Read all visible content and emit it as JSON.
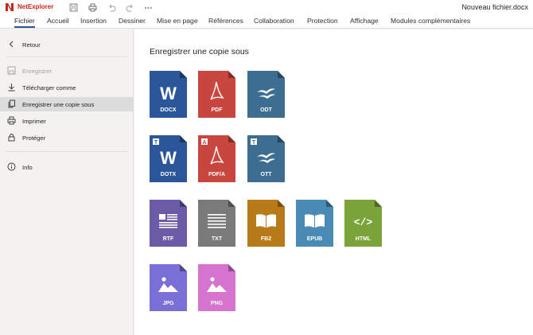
{
  "app": {
    "name": "NetExplorer",
    "document_title": "Nouveau fichier.docx",
    "brand_color": "#c8261f"
  },
  "quick_access": [
    "save-icon",
    "print-icon",
    "undo-icon",
    "redo-icon",
    "more-icon"
  ],
  "tabs": [
    {
      "label": "Fichier",
      "active": true
    },
    {
      "label": "Accueil"
    },
    {
      "label": "Insertion"
    },
    {
      "label": "Dessiner"
    },
    {
      "label": "Mise en page"
    },
    {
      "label": "Références"
    },
    {
      "label": "Collaboration"
    },
    {
      "label": "Protection"
    },
    {
      "label": "Affichage"
    },
    {
      "label": "Modules complémentaires"
    }
  ],
  "sidebar": {
    "back": {
      "label": "Retour",
      "icon": "chevron-left-icon"
    },
    "items": [
      {
        "label": "Enregistrer",
        "icon": "save-icon",
        "disabled": true
      },
      {
        "label": "Télécharger comme",
        "icon": "download-icon"
      },
      {
        "label": "Enregistrer une copie sous",
        "icon": "copy-icon",
        "selected": true
      },
      {
        "label": "Imprimer",
        "icon": "print-icon"
      },
      {
        "label": "Protéger",
        "icon": "lock-icon"
      }
    ],
    "info": {
      "label": "Info",
      "icon": "info-icon"
    }
  },
  "main": {
    "heading": "Enregistrer une copie sous",
    "formats": [
      {
        "label": "DOCX",
        "color": "#2b579a",
        "glyph": "W"
      },
      {
        "label": "PDF",
        "color": "#c8463d",
        "glyph": "pdf"
      },
      {
        "label": "ODT",
        "color": "#3d6e91",
        "glyph": "gulls"
      },
      {
        "label": "DOTX",
        "color": "#2b579a",
        "glyph": "W",
        "badge": "T"
      },
      {
        "label": "PDF/A",
        "color": "#c8463d",
        "glyph": "pdf",
        "badge": "A"
      },
      {
        "label": "OTT",
        "color": "#3d6e91",
        "glyph": "gulls",
        "badge": "T"
      },
      {
        "label": "RTF",
        "color": "#6b5aa6",
        "glyph": "rtf"
      },
      {
        "label": "TXT",
        "color": "#7a7a7a",
        "glyph": "lines"
      },
      {
        "label": "FB2",
        "color": "#b87b1a",
        "glyph": "book"
      },
      {
        "label": "EPUB",
        "color": "#4a8bb5",
        "glyph": "book"
      },
      {
        "label": "HTML",
        "color": "#7aa33a",
        "glyph": "code"
      },
      {
        "label": "JPG",
        "color": "#7a6fd6",
        "glyph": "image"
      },
      {
        "label": "PNG",
        "color": "#d673cf",
        "glyph": "image"
      }
    ]
  }
}
